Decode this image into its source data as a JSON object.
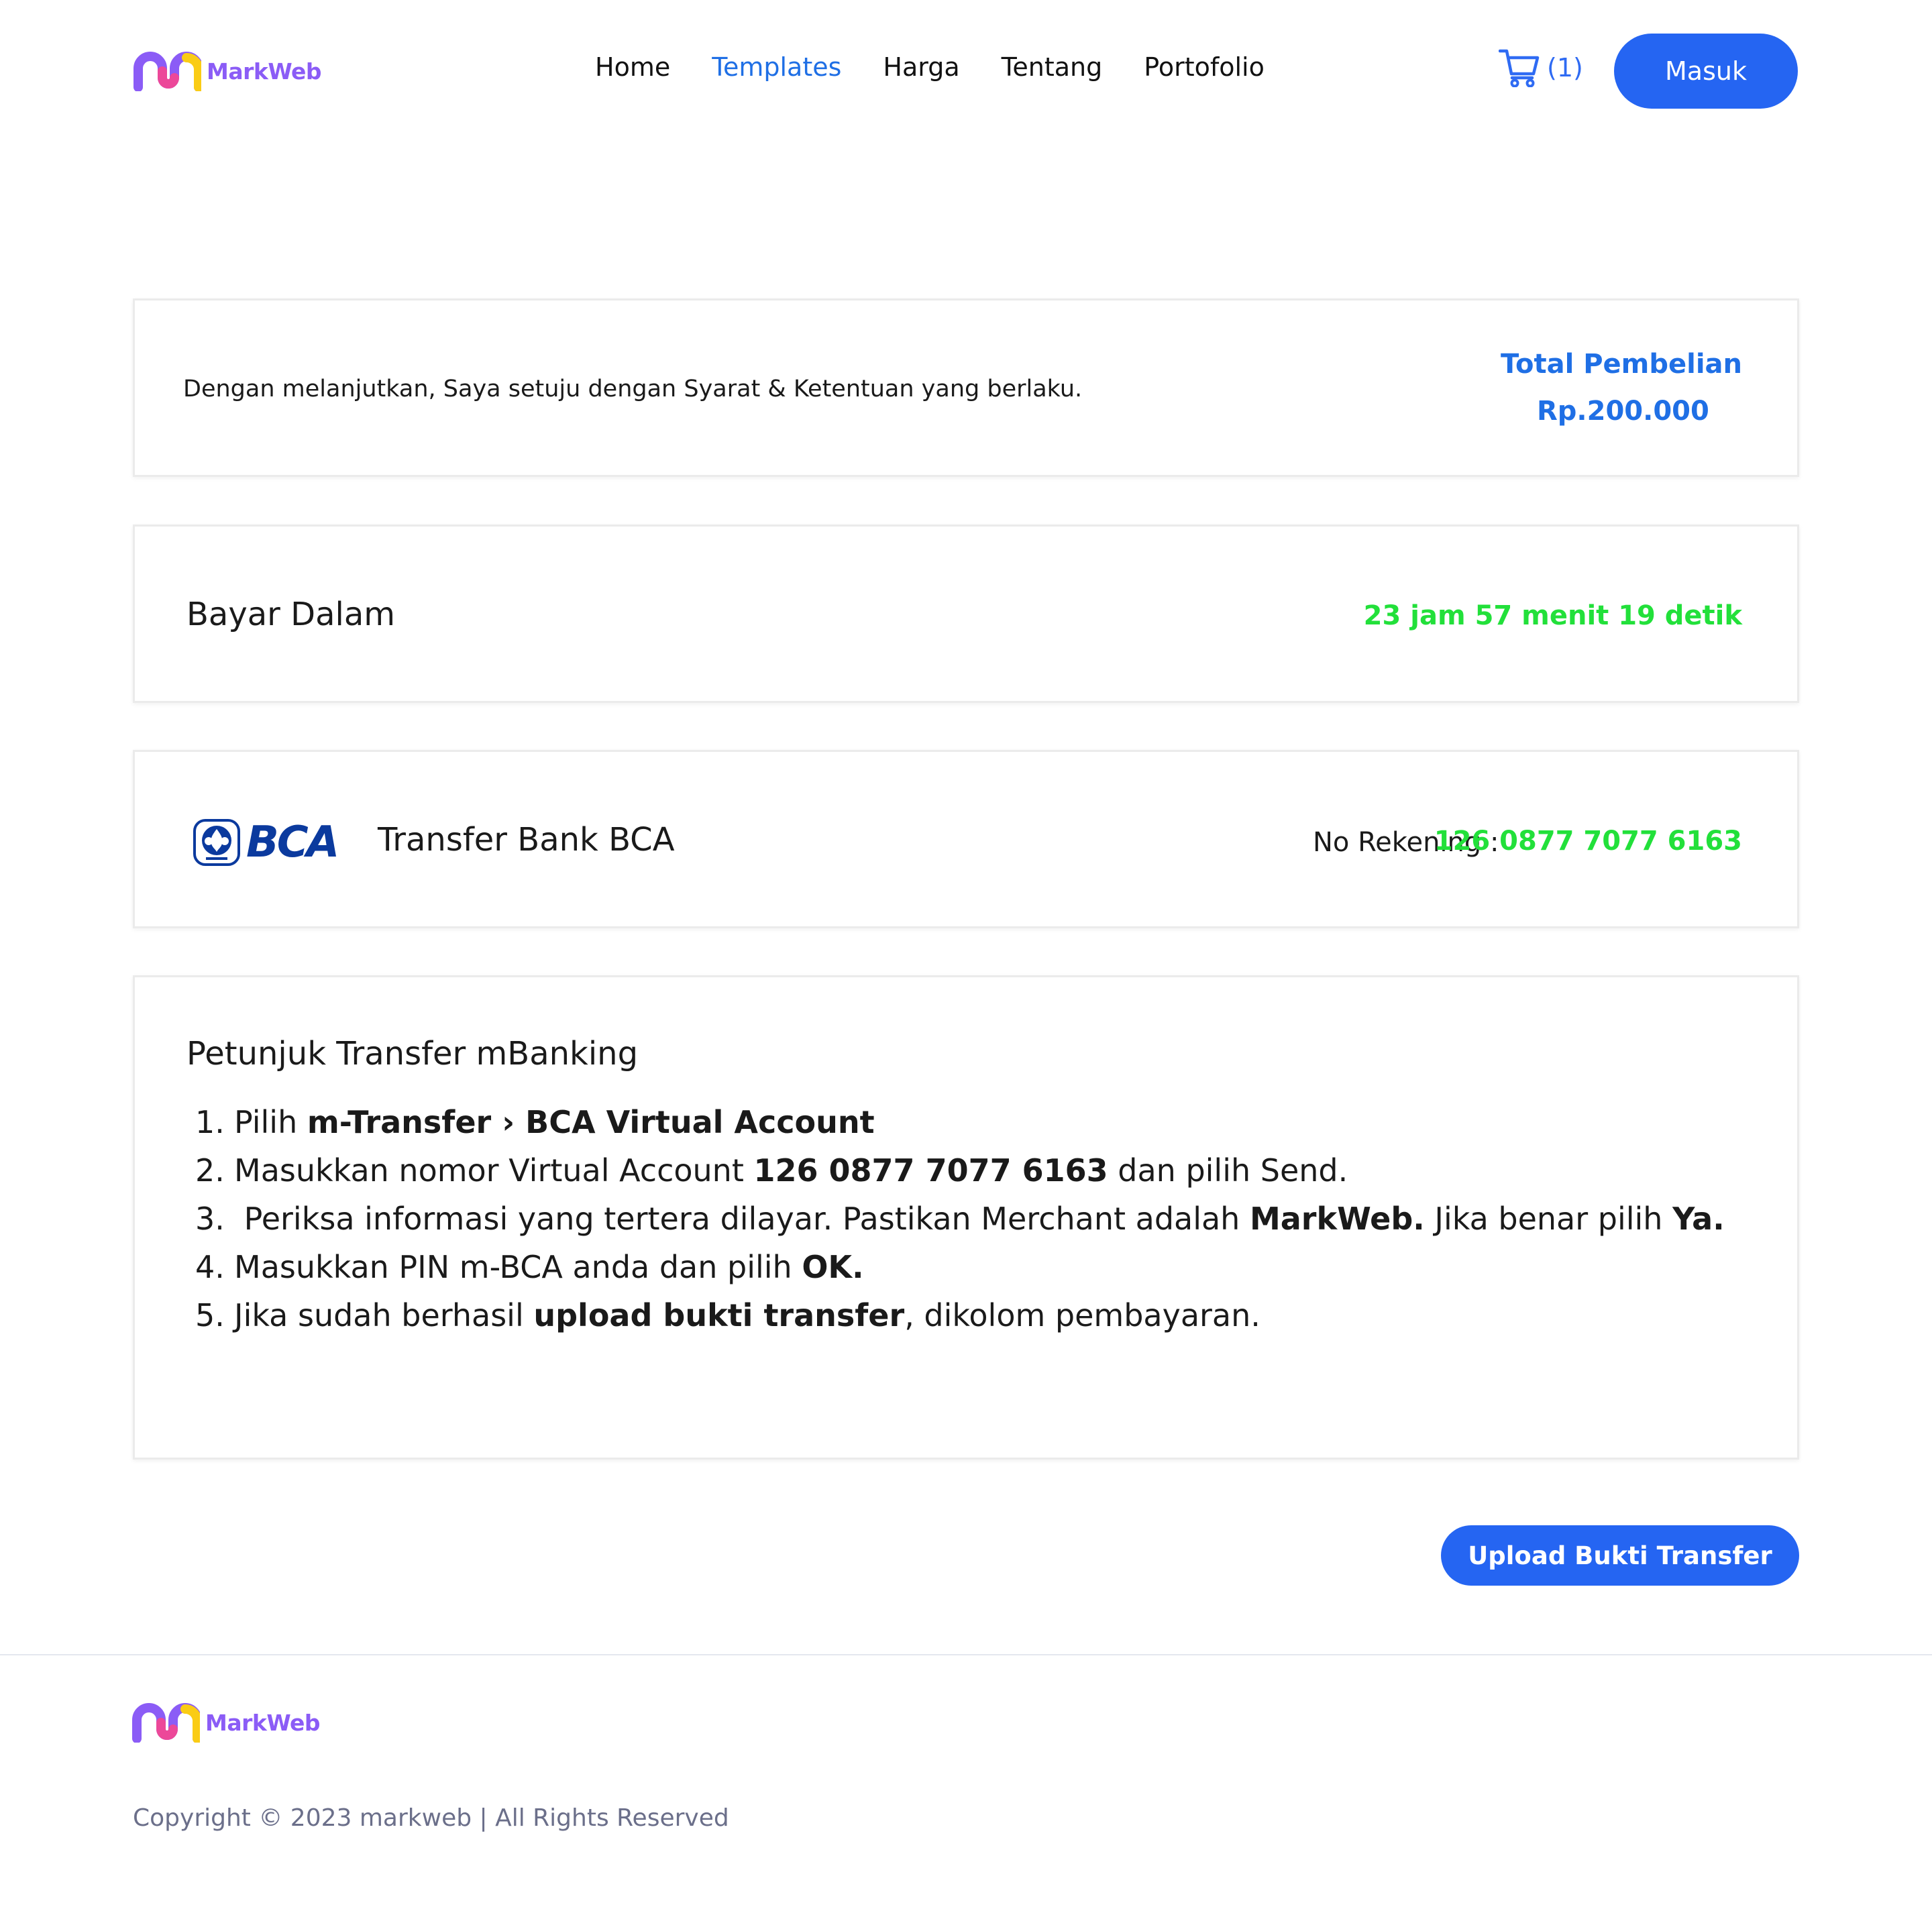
{
  "brand": {
    "name": "MarkWeb",
    "colors": {
      "logo_purple": "#8B5CF6",
      "logo_pink": "#EC4899",
      "logo_yellow": "#FACC15"
    }
  },
  "nav": {
    "items": [
      {
        "label": "Home",
        "active": false
      },
      {
        "label": "Templates",
        "active": true
      },
      {
        "label": "Harga",
        "active": false
      },
      {
        "label": "Tentang",
        "active": false
      },
      {
        "label": "Portofolio",
        "active": false
      }
    ]
  },
  "cart": {
    "icon": "cart-icon",
    "count_text": "(1)"
  },
  "login_label": "Masuk",
  "summary": {
    "terms_text": "Dengan melanjutkan, Saya setuju dengan Syarat & Ketentuan yang berlaku.",
    "total_label": "Total Pembelian",
    "total_amount": "Rp.200.000"
  },
  "payment_timer": {
    "label": "Bayar Dalam",
    "countdown": "23 jam 57 menit 19 detik"
  },
  "bank": {
    "logo_text": "BCA",
    "name": "Transfer Bank BCA",
    "account_label": "No Rekening :",
    "account_number": "126 0877 7077 6163"
  },
  "instructions": {
    "title": "Petunjuk Transfer mBanking",
    "steps": [
      {
        "num": "1.",
        "parts": [
          {
            "text": "Pilih ",
            "bold": false
          },
          {
            "text": "m-Transfer › BCA Virtual Account",
            "bold": true
          }
        ]
      },
      {
        "num": "2.",
        "parts": [
          {
            "text": "Masukkan nomor Virtual Account ",
            "bold": false
          },
          {
            "text": "126 0877 7077 6163",
            "bold": true
          },
          {
            "text": " dan pilih Send.",
            "bold": false
          }
        ]
      },
      {
        "num": "3.",
        "parts": [
          {
            "text": " Periksa informasi yang tertera dilayar. Pastikan Merchant adalah ",
            "bold": false
          },
          {
            "text": "MarkWeb.",
            "bold": true
          },
          {
            "text": " Jika benar pilih ",
            "bold": false
          },
          {
            "text": "Ya.",
            "bold": true
          }
        ]
      },
      {
        "num": "4.",
        "parts": [
          {
            "text": "Masukkan PIN m-BCA anda dan pilih ",
            "bold": false
          },
          {
            "text": "OK.",
            "bold": true
          }
        ]
      },
      {
        "num": "5.",
        "parts": [
          {
            "text": "Jika sudah berhasil ",
            "bold": false
          },
          {
            "text": "upload bukti transfer",
            "bold": true
          },
          {
            "text": ", dikolom pembayaran.",
            "bold": false
          }
        ]
      }
    ]
  },
  "upload_label": "Upload Bukti Transfer",
  "footer": {
    "copyright": "Copyright © 2023 markweb | All Rights Reserved"
  },
  "colors": {
    "primary": "#2565F2",
    "link_blue": "#1F6FE5",
    "success_green": "#22E03A",
    "bca_blue": "#0B3A9E"
  }
}
